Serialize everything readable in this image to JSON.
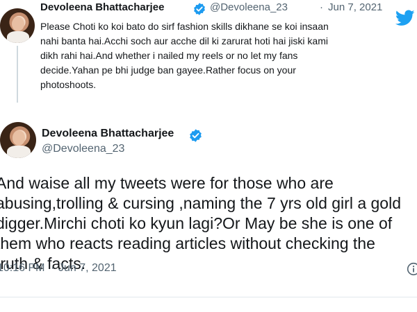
{
  "reply_tweet": {
    "author_name": "Devoleena Bhattacharjee",
    "handle": "@Devoleena_23",
    "separator": "·",
    "date": "Jun 7, 2021",
    "lines": [
      "Please Choti ko koi bato do sirf fashion skills dikhane se koi insaan",
      "nahi banta hai.Acchi soch aur acche dil ki zarurat hoti hai jiski kami",
      "dikh rahi hai.And whether i nailed my reels or no let my fans",
      "decide.Yahan pe bhi judge ban gayee.Rather focus on your",
      "photoshoots."
    ]
  },
  "main_tweet": {
    "author_name": "Devoleena Bhattacharjee",
    "handle": "@Devoleena_23",
    "lines": [
      "And waise all my tweets were for those who are",
      "abusing,trolling & cursing ,naming the 7 yrs old girl a gold",
      "digger.Mirchi choti ko kyun lagi?Or May be she is one of",
      "them who reacts reading articles without checking the",
      "truth & facts."
    ],
    "time": "10:16 PM",
    "separator": "·",
    "date": "Jun 7, 2021"
  },
  "icons": {
    "verified": "verified-badge-icon",
    "brand": "twitter-bird-icon",
    "info": "info-icon"
  },
  "colors": {
    "verified": "#1d9bf0",
    "brand": "#1da1f2",
    "secondary_text": "#536471",
    "thread_line": "#cfd9de"
  }
}
